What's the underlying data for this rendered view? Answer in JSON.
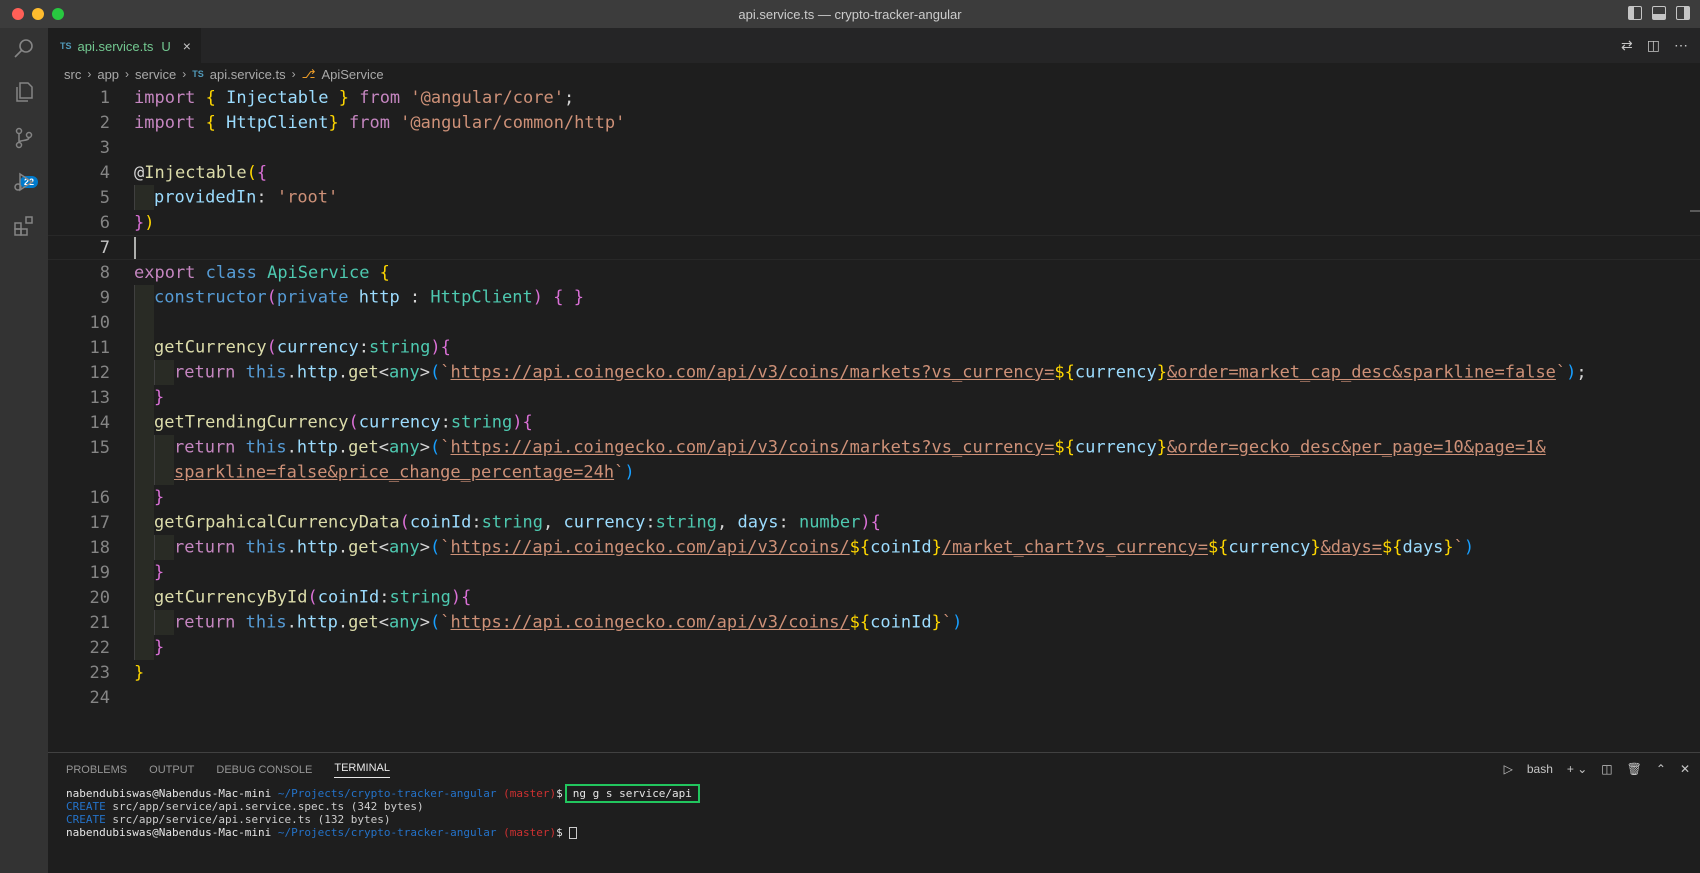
{
  "window": {
    "title": "api.service.ts — crypto-tracker-angular"
  },
  "activity": {
    "scm_badge": "22"
  },
  "tab": {
    "lang": "TS",
    "name": "api.service.ts",
    "status": "U",
    "close": "×"
  },
  "breadcrumb": {
    "seg1": "src",
    "seg2": "app",
    "seg3": "service",
    "ts": "TS",
    "file": "api.service.ts",
    "symbol": "ApiService"
  },
  "code": {
    "l1": {
      "a": "import",
      "b": " { ",
      "c": "Injectable",
      "d": " } ",
      "e": "from",
      "f": " '@angular/core'",
      "g": ";"
    },
    "l2": {
      "a": "import",
      "b": " { ",
      "c": "HttpClient",
      "d": "} ",
      "e": "from",
      "f": " '@angular/common/http'"
    },
    "l4": {
      "a": "@",
      "b": "Injectable",
      "c": "(",
      "d": "{"
    },
    "l5": {
      "a": "providedIn",
      "b": ": ",
      "c": "'root'"
    },
    "l6": {
      "a": "}",
      "b": ")"
    },
    "l8": {
      "a": "export",
      "b": " class ",
      "c": "ApiService",
      "d": " {"
    },
    "l9": {
      "a": "constructor",
      "b": "(",
      "c": "private",
      "d": " http",
      "e": " : ",
      "f": "HttpClient",
      "g": ")",
      "h": " { }"
    },
    "l11": {
      "a": "getCurrency",
      "b": "(",
      "c": "currency",
      "d": ":",
      "e": "string",
      "f": ")",
      "g": "{"
    },
    "l12": {
      "a": "return",
      "b": " this",
      "c": ".",
      "d": "http",
      "e": ".",
      "f": "get",
      "g": "<",
      "h": "any",
      "i": ">",
      "j": "(",
      "k": "`",
      "l": "https://api.coingecko.com/api/v3/coins/markets?vs_currency=",
      "m": "${",
      "n": "currency",
      "o": "}",
      "p": "&order=market_cap_desc&sparkline=false",
      "q": "`",
      "r": ")",
      "s": ";"
    },
    "l13": {
      "a": "}"
    },
    "l14": {
      "a": "getTrendingCurrency",
      "b": "(",
      "c": "currency",
      "d": ":",
      "e": "string",
      "f": ")",
      "g": "{"
    },
    "l15": {
      "a": "return",
      "b": " this",
      "c": ".",
      "d": "http",
      "e": ".",
      "f": "get",
      "g": "<",
      "h": "any",
      "i": ">",
      "j": "(",
      "k": "`",
      "l": "https://api.coingecko.com/api/v3/coins/markets?vs_currency=",
      "m": "${",
      "n": "currency",
      "o": "}",
      "p": "&order=gecko_desc&per_page=10&page=1&"
    },
    "l15b": {
      "a": "sparkline=false&price_change_percentage=24h",
      "b": "`",
      "c": ")"
    },
    "l16": {
      "a": "}"
    },
    "l17": {
      "a": "getGrpahicalCurrencyData",
      "b": "(",
      "c": "coinId",
      "d": ":",
      "e": "string",
      "f": ", ",
      "g": "currency",
      "h": ":",
      "i": "string",
      "j": ", ",
      "k": "days",
      "l": ": ",
      "m": "number",
      "n": ")",
      "o": "{"
    },
    "l18": {
      "a": "return",
      "b": " this",
      "c": ".",
      "d": "http",
      "e": ".",
      "f": "get",
      "g": "<",
      "h": "any",
      "i": ">",
      "j": "(",
      "k": "`",
      "l": "https://api.coingecko.com/api/v3/coins/",
      "m": "${",
      "n": "coinId",
      "o": "}",
      "p": "/market_chart?vs_currency=",
      "q": "${",
      "r": "currency",
      "s": "}",
      "t": "&days=",
      "u": "${",
      "v": "days",
      "w": "}",
      "x": "`",
      "y": ")"
    },
    "l19": {
      "a": "}"
    },
    "l20": {
      "a": "getCurrencyById",
      "b": "(",
      "c": "coinId",
      "d": ":",
      "e": "string",
      "f": ")",
      "g": "{"
    },
    "l21": {
      "a": "return",
      "b": " this",
      "c": ".",
      "d": "http",
      "e": ".",
      "f": "get",
      "g": "<",
      "h": "any",
      "i": ">",
      "j": "(",
      "k": "`",
      "l": "https://api.coingecko.com/api/v3/coins/",
      "m": "${",
      "n": "coinId",
      "o": "}",
      "p": "`",
      "q": ")"
    },
    "l22": {
      "a": "}"
    },
    "l23": {
      "a": "}"
    }
  },
  "line_numbers": [
    "1",
    "2",
    "3",
    "4",
    "5",
    "6",
    "7",
    "8",
    "9",
    "10",
    "11",
    "12",
    "13",
    "14",
    "15",
    "16",
    "17",
    "18",
    "19",
    "20",
    "21",
    "22",
    "23",
    "24"
  ],
  "panel": {
    "tabs": [
      "PROBLEMS",
      "OUTPUT",
      "DEBUG CONSOLE",
      "TERMINAL"
    ],
    "shell": "bash",
    "terminal": {
      "user": "nabendubiswas@Nabendus-Mac-mini",
      "path": " ~/Projects/crypto-tracker-angular",
      "branch": " (master)",
      "prompt": "$",
      "command": "ng g s  service/api",
      "create": "CREATE",
      "out1": " src/app/service/api.service.spec.ts (342 bytes)",
      "out2": " src/app/service/api.service.ts (132 bytes)"
    }
  }
}
